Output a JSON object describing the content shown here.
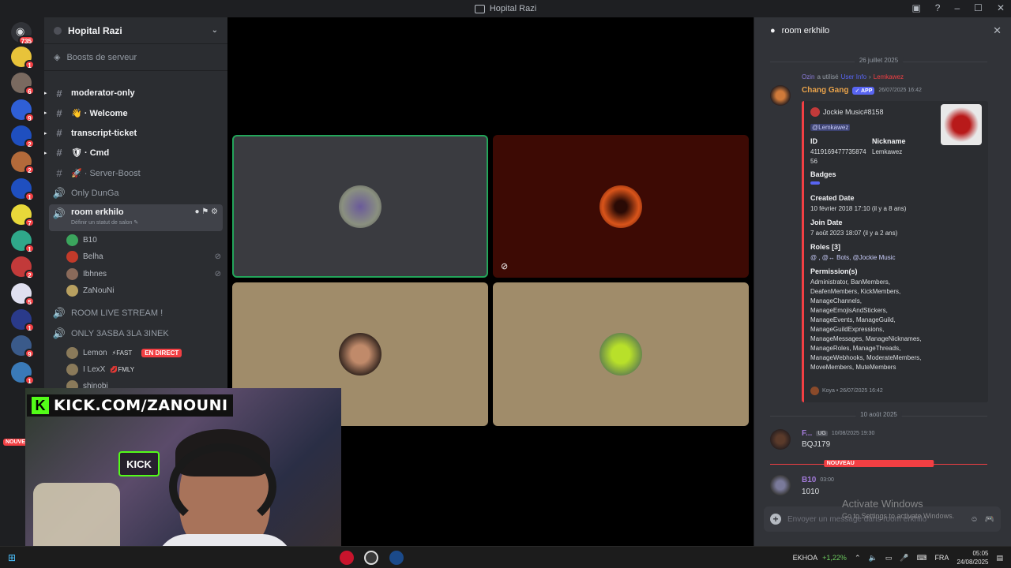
{
  "window": {
    "title": "Hopital Razi"
  },
  "server_rail": {
    "home_badge": "735",
    "servers": [
      {
        "name": "server-1",
        "color": "#e8c33a",
        "badge": "1"
      },
      {
        "name": "server-2",
        "color": "#7a6a60",
        "badge": "6"
      },
      {
        "name": "server-3",
        "color": "#2f5fd6",
        "badge": "9"
      },
      {
        "name": "server-4",
        "color": "#1f4fbf",
        "badge": "2"
      },
      {
        "name": "server-5",
        "color": "#b36a3a",
        "badge": "2"
      },
      {
        "name": "server-6",
        "color": "#1f4fbf",
        "badge": "1"
      },
      {
        "name": "server-7",
        "color": "#e8d83a",
        "badge": "7"
      },
      {
        "name": "server-8",
        "color": "#2fa88a",
        "badge": "1"
      },
      {
        "name": "server-9",
        "color": "#c23a3a",
        "badge": "2"
      },
      {
        "name": "server-10",
        "color": "#e0e0f0",
        "badge": "5"
      },
      {
        "name": "server-11",
        "color": "#2a3a8a",
        "badge": "1"
      },
      {
        "name": "server-12",
        "color": "#3a5a8a",
        "badge": "9"
      },
      {
        "name": "server-13",
        "color": "#3a7ab8",
        "badge": "1"
      }
    ],
    "new_label": "NOUVE"
  },
  "sidebar": {
    "server_name": "Hopital Razi",
    "boost_label": "Boosts de serveur",
    "channels": [
      {
        "icon": "#",
        "label": "moderator-only",
        "unread": true
      },
      {
        "icon": "#",
        "label": "👋 · Welcome",
        "unread": true
      },
      {
        "icon": "#",
        "label": "transcript-ticket",
        "unread": true
      },
      {
        "icon": "#",
        "label": "🛡 · Cmd",
        "unread": true
      },
      {
        "icon": "#",
        "label": "🚀 · Server-Boost",
        "unread": false
      },
      {
        "icon": "🔊",
        "label": "Only DunGa",
        "unread": false
      }
    ],
    "active_channel": {
      "label": "room erkhilo",
      "status": "Définir un statut de salon ✎"
    },
    "voice_users": [
      {
        "name": "B10",
        "color": "#3ba55d"
      },
      {
        "name": "Belha",
        "color": "#c23a2a"
      },
      {
        "name": "Ibhnes",
        "color": "#8a6a5a"
      },
      {
        "name": "ZaNouNi",
        "color": "#b8a060"
      }
    ],
    "other_channels": [
      {
        "label": "ROOM LIVE STREAM !"
      },
      {
        "label": "ONLY 3ASBA 3LA 3INEK"
      }
    ],
    "live_users": [
      {
        "name": "Lemon",
        "tag": "⚡FAST",
        "live": "EN DIRECT"
      },
      {
        "name": "I LexX",
        "tag": "💋FMLY"
      },
      {
        "name": "shinobi",
        "tag": ""
      }
    ]
  },
  "stage": {
    "tiles": [
      {
        "name": "tile-1",
        "bg": "#3a3b40",
        "avatar": "#6a5a9a",
        "speaking": true
      },
      {
        "name": "tile-2",
        "bg": "#3d0a04",
        "avatar": "#d9541a",
        "speaking": false
      },
      {
        "name": "tile-3",
        "bg": "#a08c6a",
        "avatar": "#5a3a2a",
        "speaking": false
      },
      {
        "name": "tile-4",
        "bg": "#a08c6a",
        "avatar": "#b8e02a",
        "speaking": false
      }
    ]
  },
  "webcam": {
    "banner": "KICK.COM/ZANOUNI",
    "sign": "KICK"
  },
  "panel": {
    "title": "room erkhilo",
    "date1": "26 juillet 2025",
    "reply_user": "Ozin",
    "reply_text": "a utilisé",
    "reply_cmd": "User Info",
    "reply_target": "Lemkawez",
    "bot_name": "Chang Gang",
    "bot_tag": "✓ APP",
    "bot_time": "26/07/2025 16:42",
    "embed": {
      "author": "Jockie Music#8158",
      "mention": "@Lemkawez",
      "id_label": "ID",
      "id_value": "4119169477735874 56",
      "nick_label": "Nickname",
      "nick_value": "Lemkawez",
      "badges_label": "Badges",
      "created_label": "Created Date",
      "created_value": "10 février 2018 17:10 (il y a 8 ans)",
      "join_label": "Join Date",
      "join_value": "7 août 2023 18:07 (il y a 2 ans)",
      "roles_label": "Roles [3]",
      "roles_value": "@ , @↔ Bots, @Jockie Music",
      "perm_label": "Permission(s)",
      "perm_value": "Administrator, BanMembers, DeafenMembers, KickMembers, ManageChannels, ManageEmojisAndStickers, ManageEvents, ManageGuild, ManageGuildExpressions, ManageMessages, ManageNicknames, ManageRoles, ManageThreads, ManageWebhooks, ModerateMembers, MoveMembers, MuteMembers",
      "footer": "Koya • 26/07/2025 16:42"
    },
    "date2": "10 août 2025",
    "msg2_user": "F...",
    "msg2_tag": "UG",
    "msg2_time": "10/08/2025 19:30",
    "msg2_text": "BQJ179",
    "new_label": "NOUVEAU",
    "msg3_user": "B10",
    "msg3_time": "03:00",
    "msg3_text": "1010",
    "composer_placeholder": "Envoyer un message dans room erkhilo"
  },
  "watermark": {
    "title": "Activate Windows",
    "sub": "Go to Settings to activate Windows."
  },
  "taskbar": {
    "stock_name": "EKHOA",
    "stock_change": "+1,22%",
    "lang": "FRA",
    "time": "05:05",
    "date": "24/08/2025"
  }
}
